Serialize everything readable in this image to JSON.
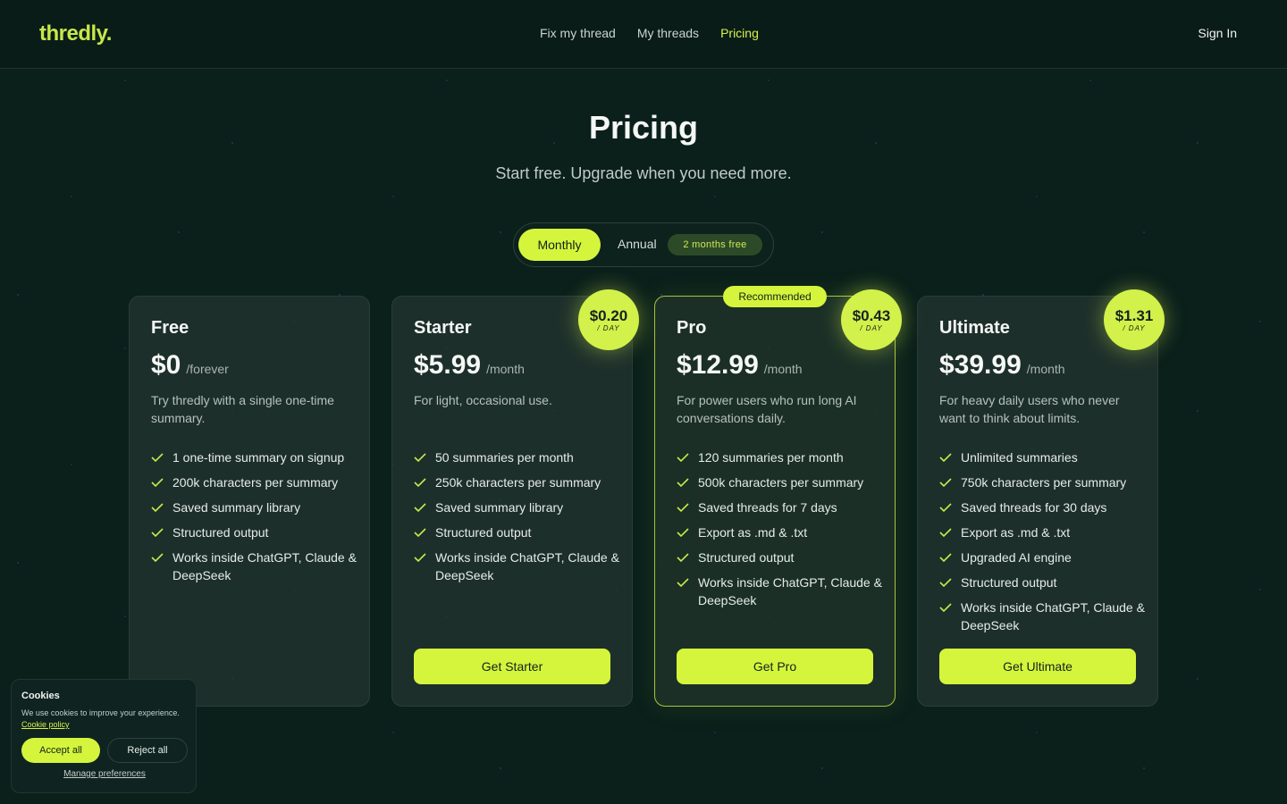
{
  "brand": {
    "logo": "thredly."
  },
  "nav": {
    "items": [
      {
        "label": "Fix my thread",
        "active": false
      },
      {
        "label": "My threads",
        "active": false
      },
      {
        "label": "Pricing",
        "active": true
      }
    ],
    "signin": "Sign In"
  },
  "hero": {
    "title": "Pricing",
    "subtitle": "Start free. Upgrade when you need more."
  },
  "billing_toggle": {
    "monthly": "Monthly",
    "annual": "Annual",
    "annual_badge": "2 months free",
    "selected": "Monthly"
  },
  "plans": [
    {
      "name": "Free",
      "price": "$0",
      "period": "/forever",
      "desc": "Try thredly with a single one-time summary.",
      "features": [
        "1 one-time summary on signup",
        "200k characters per summary",
        "Saved summary library",
        "Structured output",
        "Works inside ChatGPT, Claude & DeepSeek"
      ]
    },
    {
      "name": "Starter",
      "price": "$5.99",
      "period": "/month",
      "desc": "For light, occasional use.",
      "per_day": "$0.20",
      "per_day_unit": "/ DAY",
      "features": [
        "50 summaries per month",
        "250k characters per summary",
        "Saved summary library",
        "Structured output",
        "Works inside ChatGPT, Claude & DeepSeek"
      ],
      "cta": "Get Starter"
    },
    {
      "name": "Pro",
      "price": "$12.99",
      "period": "/month",
      "desc": "For power users who run long AI conversations daily.",
      "per_day": "$0.43",
      "per_day_unit": "/ DAY",
      "badge": "Recommended",
      "features": [
        "120 summaries per month",
        "500k characters per summary",
        "Saved threads for 7 days",
        "Export as .md & .txt",
        "Structured output",
        "Works inside ChatGPT, Claude & DeepSeek"
      ],
      "cta": "Get Pro"
    },
    {
      "name": "Ultimate",
      "price": "$39.99",
      "period": "/month",
      "desc": "For heavy daily users who never want to think about limits.",
      "per_day": "$1.31",
      "per_day_unit": "/ DAY",
      "features": [
        "Unlimited summaries",
        "750k characters per summary",
        "Saved threads for 30 days",
        "Export as .md & .txt",
        "Upgraded AI engine",
        "Structured output",
        "Works inside ChatGPT, Claude & DeepSeek"
      ],
      "cta": "Get Ultimate"
    }
  ],
  "cookie": {
    "title": "Cookies",
    "text": "We use cookies to improve your experience.",
    "link": "Cookie policy",
    "accept": "Accept all",
    "reject": "Reject all",
    "manage": "Manage preferences"
  },
  "colors": {
    "accent": "#d4f53c",
    "background": "#0b1f1b"
  }
}
